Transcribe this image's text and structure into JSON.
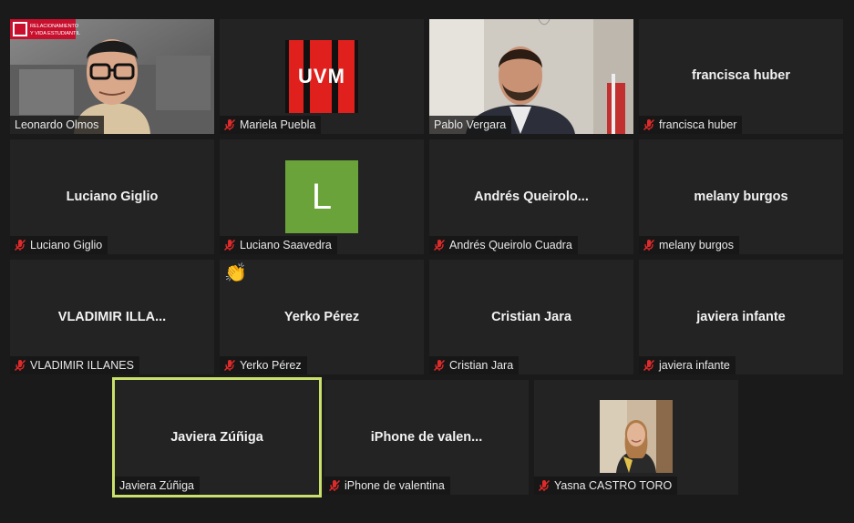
{
  "colors": {
    "background": "#1a1a1a",
    "tile": "#232323",
    "active_speaker_border": "#c9e06c",
    "muted_icon": "#e02a2a",
    "letter_avatar": "#6aa33a",
    "uvm_red": "#e0201c"
  },
  "tiles": [
    {
      "name": "Leonardo Olmos",
      "muted": false,
      "type": "video"
    },
    {
      "name": "Mariela Puebla",
      "muted": true,
      "type": "logo",
      "logo_text": "UVM"
    },
    {
      "name": "Pablo Vergara",
      "muted": false,
      "type": "video"
    },
    {
      "name": "francisca huber",
      "muted": true,
      "type": "name",
      "display": "francisca huber"
    },
    {
      "name": "Luciano Giglio",
      "muted": true,
      "type": "name",
      "display": "Luciano Giglio"
    },
    {
      "name": "Luciano Saavedra",
      "muted": true,
      "type": "letter",
      "letter": "L"
    },
    {
      "name": "Andrés Queirolo Cuadra",
      "muted": true,
      "type": "name",
      "display": "Andrés  Queirolo..."
    },
    {
      "name": "melany burgos",
      "muted": true,
      "type": "name",
      "display": "melany burgos"
    },
    {
      "name": "VLADIMIR ILLANES",
      "muted": true,
      "type": "name",
      "display": "VLADIMIR ILLA..."
    },
    {
      "name": "Yerko Pérez",
      "muted": true,
      "type": "name",
      "display": "Yerko Pérez",
      "reaction": "clap-emoji"
    },
    {
      "name": "Cristian Jara",
      "muted": true,
      "type": "name",
      "display": "Cristian Jara"
    },
    {
      "name": "javiera infante",
      "muted": true,
      "type": "name",
      "display": "javiera infante"
    },
    {
      "name": "Javiera Zúñiga",
      "muted": false,
      "type": "name",
      "display": "Javiera Zúñiga",
      "active": true
    },
    {
      "name": "iPhone de valentina",
      "muted": true,
      "type": "name",
      "display": "iPhone  de  valen..."
    },
    {
      "name": "Yasna CASTRO TORO",
      "muted": true,
      "type": "photo"
    }
  ],
  "video_overlay": {
    "banner_line1": "RELACIONAMIENTO",
    "banner_line2": "Y VIDA ESTUDIANTIL"
  }
}
